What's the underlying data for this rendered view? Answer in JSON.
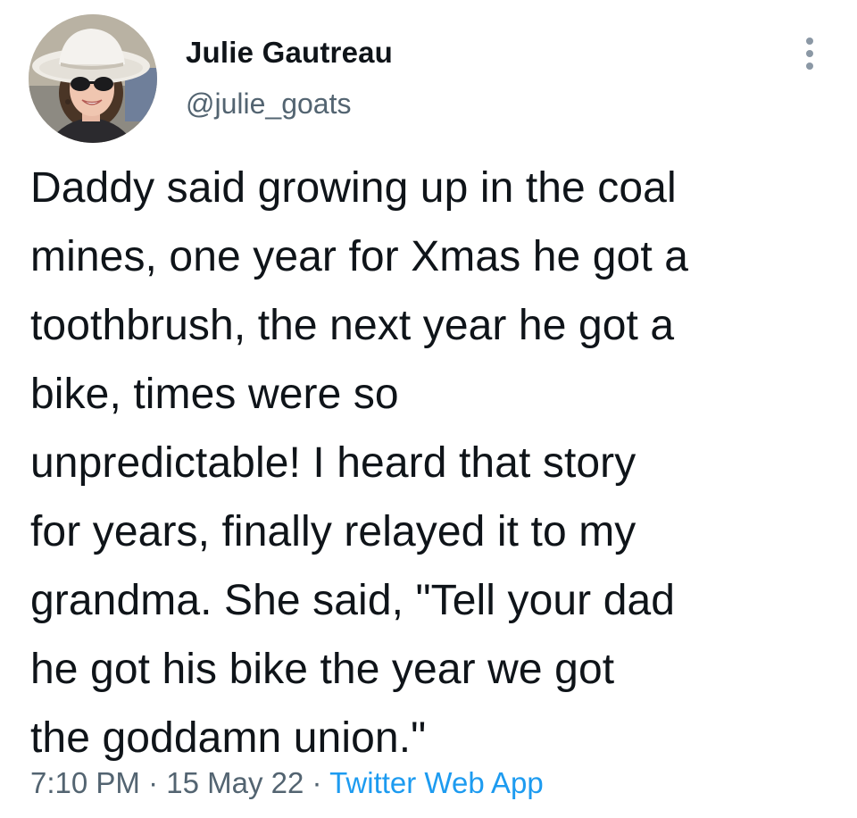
{
  "author": {
    "display_name": "Julie Gautreau",
    "handle": "@julie_goats",
    "avatar_icon": "profile-photo"
  },
  "tweet": {
    "text": "Daddy said growing up in the coal\nmines, one year for Xmas he got a\ntoothbrush, the next year he got a\nbike, times were so\nunpredictable! I heard that story\nfor years, finally relayed it to my\ngrandma. She said, \"Tell your dad\nhe got his bike the year we got\nthe goddamn union.\""
  },
  "meta": {
    "time": "7:10 PM",
    "separator": " · ",
    "date": "15 May 22",
    "source": "Twitter Web App"
  },
  "menu": {
    "icon": "more-vertical-icon"
  },
  "colors": {
    "text": "#0f1419",
    "secondary": "#536471",
    "link": "#1d9bf0"
  }
}
